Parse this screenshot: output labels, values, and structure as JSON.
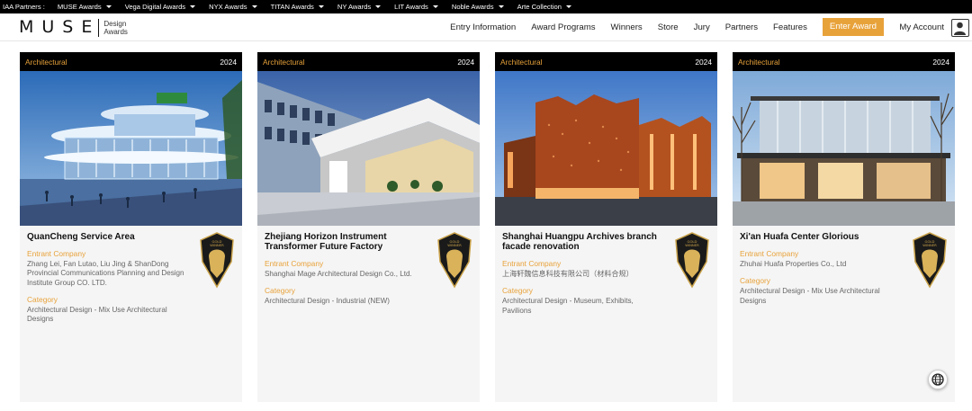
{
  "partner_bar": {
    "lead": "IAA Partners :",
    "items": [
      "MUSE Awards",
      "Vega Digital Awards",
      "NYX Awards",
      "TITAN Awards",
      "NY Awards",
      "LIT Awards",
      "Noble Awards",
      "Arte Collection"
    ]
  },
  "logo": {
    "wordmark": "MUSE",
    "sub_line1": "Design",
    "sub_line2": "Awards"
  },
  "nav": {
    "items": [
      "Entry Information",
      "Award Programs",
      "Winners",
      "Store",
      "Jury",
      "Partners",
      "Features"
    ],
    "cta": "Enter Award",
    "account": "My Account"
  },
  "colors": {
    "accent": "#e8a23a",
    "bar": "#000000",
    "card_bg": "#f5f5f5"
  },
  "badge_text": [
    "GOLD",
    "WINNER"
  ],
  "cards": [
    {
      "category_tag": "Architectural",
      "year": "2024",
      "title": "QuanCheng Service Area",
      "entrant_label": "Entrant Company",
      "entrant": "Zhang Lei,   Fan Lutao,   Liu Jing & ShanDong Provincial Communications Planning and Design Institute Group CO. LTD.",
      "category_label": "Category",
      "category": "Architectural Design - Mix Use Architectural Designs",
      "image": "service-area-building"
    },
    {
      "category_tag": "Architectural",
      "year": "2024",
      "title": "Zhejiang Horizon Instrument Transformer Future Factory",
      "entrant_label": "Entrant Company",
      "entrant": "Shanghai Mage Architectural Design Co., Ltd.",
      "category_label": "Category",
      "category": "Architectural Design - Industrial (NEW)",
      "image": "factory-building"
    },
    {
      "category_tag": "Architectural",
      "year": "2024",
      "title": "Shanghai Huangpu Archives branch facade renovation",
      "entrant_label": "Entrant Company",
      "entrant": "上海轩魏信息科技有限公司（材料合规）",
      "category_label": "Category",
      "category": "Architectural Design - Museum, Exhibits, Pavilions",
      "image": "copper-facade-building"
    },
    {
      "category_tag": "Architectural",
      "year": "2024",
      "title": "Xi'an Huafa Center Glorious",
      "entrant_label": "Entrant Company",
      "entrant": "Zhuhai Huafa Properties Co., Ltd",
      "category_label": "Category",
      "category": "Architectural Design - Mix Use Architectural Designs",
      "image": "glass-pavilion-building"
    }
  ],
  "globe_icon": "globe-icon"
}
